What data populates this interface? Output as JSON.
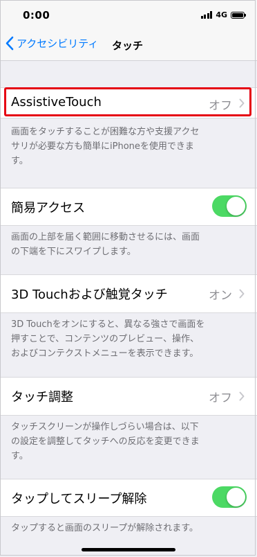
{
  "status": {
    "time": "0:00",
    "network": "4G"
  },
  "nav": {
    "back_label": "アクセシビリティ",
    "title": "タッチ"
  },
  "rows": [
    {
      "label": "AssistiveTouch",
      "value": "オフ",
      "footer": [
        "画面をタッチすることが困難な方や支援アクセ",
        "サリが必要な方も簡単にiPhoneを使用できま",
        "す。"
      ]
    },
    {
      "label": "簡易アクセス",
      "toggle": true,
      "footer": [
        "画面の上部を届く範囲に移動させるには、画面",
        "の下端を下にスワイプします。"
      ]
    },
    {
      "label": "3D Touchおよび触覚タッチ",
      "value": "オン",
      "footer": [
        "3D Touchをオンにすると、異なる強さで画面を",
        "押すことで、コンテンツのプレビュー、操作、",
        "およびコンテクストメニューを表示できます。"
      ]
    },
    {
      "label": "タッチ調整",
      "value": "オフ",
      "footer": [
        "タッチスクリーンが操作しづらい場合は、以下",
        "の設定を調整してタッチへの反応を変更できま",
        "す。"
      ]
    },
    {
      "label": "タップしてスリープ解除",
      "toggle": true,
      "footer": [
        "タップすると画面のスリープが解除されます。"
      ]
    }
  ],
  "colors": {
    "accent": "#007aff",
    "toggle_on": "#4cd964",
    "highlight": "#e50012"
  }
}
